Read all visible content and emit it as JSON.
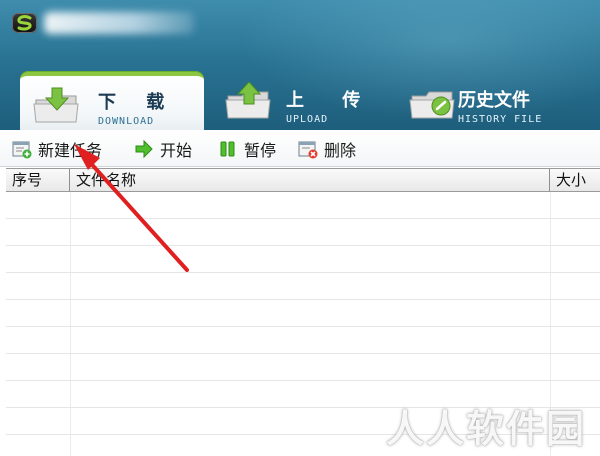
{
  "header": {
    "tabs": [
      {
        "label": "下 载",
        "sub": "DOWNLOAD"
      },
      {
        "label": "上 传",
        "sub": "UPLOAD"
      },
      {
        "label": "历史文件",
        "sub": "HISTORY FILE"
      }
    ],
    "active_tab": 0
  },
  "toolbar": {
    "new_task": "新建任务",
    "start": "开始",
    "pause": "暂停",
    "delete": "删除"
  },
  "table": {
    "columns": [
      "序号",
      "文件名称",
      "大小"
    ]
  },
  "watermark": "人人软件园",
  "colors": {
    "header_top": "#3f8dad",
    "header_bottom": "#1d5e7c",
    "active_tab_accent": "#8dc63f",
    "annotation_arrow": "#e02020"
  }
}
